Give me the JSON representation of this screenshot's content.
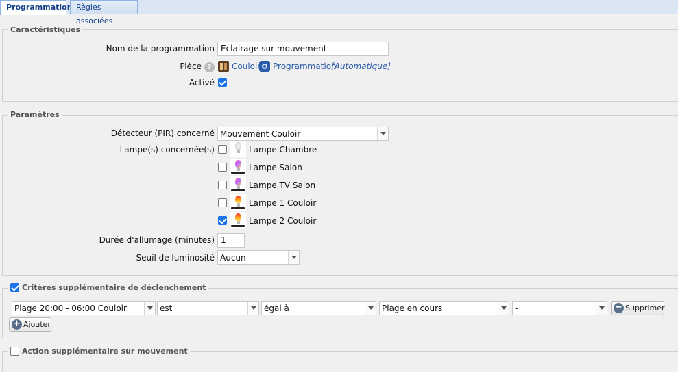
{
  "tabs": [
    {
      "label": "Programmation",
      "active": true
    },
    {
      "label": "Règles associées",
      "active": false
    }
  ],
  "caracteristiques": {
    "legend": "Caractéristiques",
    "nom_label": "Nom de la programmation",
    "nom_value": "Eclairage sur mouvement",
    "piece_label": "Pièce",
    "piece_room": "Couloir",
    "piece_prog": "Programmation",
    "piece_mode": "[Automatique]",
    "active_label": "Activé",
    "active_checked": true
  },
  "parametres": {
    "legend": "Paramètres",
    "detecteur_label": "Détecteur (PIR) concerné",
    "detecteur_value": "Mouvement Couloir",
    "lampes_label": "Lampe(s) concernée(s)",
    "lampes": [
      {
        "name": "Lampe Chambre",
        "checked": false,
        "icon": "white-bulb-icon"
      },
      {
        "name": "Lampe Salon",
        "checked": false,
        "icon": "color-bulb-icon"
      },
      {
        "name": "Lampe TV Salon",
        "checked": false,
        "icon": "color-bulb-icon"
      },
      {
        "name": "Lampe 1 Couloir",
        "checked": false,
        "icon": "warm-bulb-icon"
      },
      {
        "name": "Lampe 2 Couloir",
        "checked": true,
        "icon": "warm-bulb-icon"
      }
    ],
    "duree_label": "Durée d'allumage (minutes)",
    "duree_value": "1",
    "seuil_label": "Seuil de luminosité",
    "seuil_value": "Aucun"
  },
  "criteres": {
    "legend": "Critères supplémentaire de déclenchement",
    "checked": true,
    "row": {
      "field1": "Plage 20:00 - 06:00 Couloir",
      "field2": "est",
      "field3": "égal à",
      "field4": "Plage en cours",
      "field5": "-"
    },
    "supprimer_label": "Supprimer",
    "ajouter_label": "Ajouter"
  },
  "action": {
    "legend": "Action supplémentaire sur mouvement",
    "checked": false
  }
}
